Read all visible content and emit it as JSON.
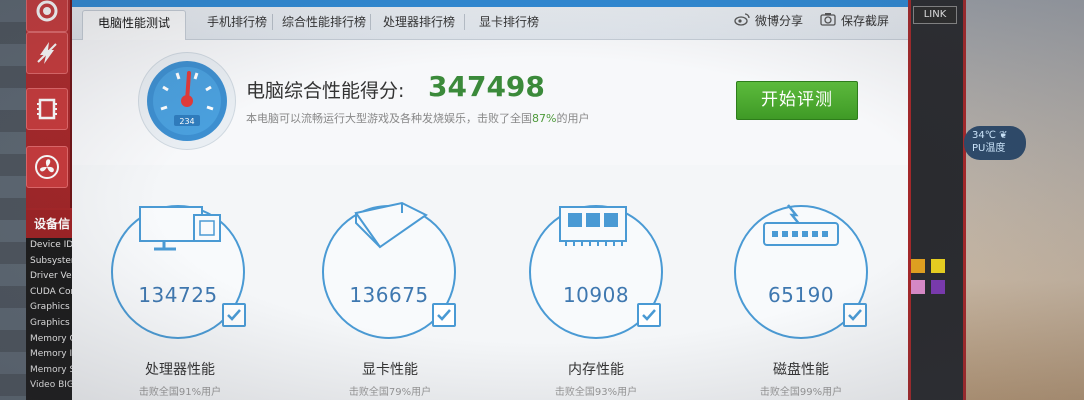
{
  "window": {
    "tabs": [
      {
        "label": "电脑性能测试",
        "active": true
      },
      {
        "label": "手机排行榜",
        "active": false
      },
      {
        "label": "综合性能排行榜",
        "active": false
      },
      {
        "label": "处理器排行榜",
        "active": false
      },
      {
        "label": "显卡排行榜",
        "active": false
      }
    ],
    "share_weibo": "微博分享",
    "save_screenshot": "保存截屏"
  },
  "overall": {
    "label": "电脑综合性能得分:",
    "score": "347498",
    "desc_prefix": "本电脑可以流畅运行大型游戏及各种发烧娱乐，击败了全国",
    "desc_pct": "87%",
    "desc_suffix": "的用户",
    "gauge_reading": "234",
    "start_button": "开始评测"
  },
  "cards": [
    {
      "title": "处理器性能",
      "score": "134725",
      "sub": "击败全国91%用户",
      "icon": "cpu-monitor-icon"
    },
    {
      "title": "显卡性能",
      "score": "136675",
      "sub": "击败全国79%用户",
      "icon": "gpu-cube-icon"
    },
    {
      "title": "内存性能",
      "score": "10908",
      "sub": "击败全国93%用户",
      "icon": "memory-stick-icon"
    },
    {
      "title": "磁盘性能",
      "score": "65190",
      "sub": "击败全国99%用户",
      "icon": "disk-drive-icon"
    }
  ],
  "background_app": {
    "device_title": "设备信",
    "device_items": [
      "Device ID",
      "Subsystem",
      "Driver Ver",
      "CUDA Cor",
      "Graphics",
      "Graphics",
      "Memory Co",
      "Memory In",
      "Memory S",
      "Video BIG"
    ],
    "link_button": "LINK",
    "temp_value": "34℃",
    "temp_label": "PU温度"
  },
  "colors": {
    "accent_blue": "#4a9ad4",
    "score_green": "#3b8a3a",
    "button_green": "#4caa30",
    "rail_red": "#b32a2c"
  }
}
